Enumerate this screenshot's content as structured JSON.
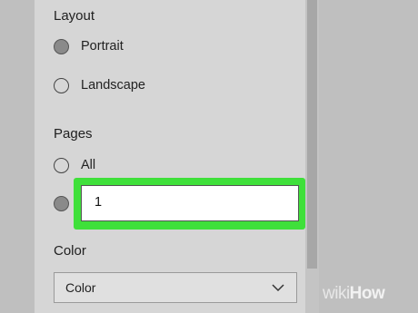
{
  "layout": {
    "title": "Layout",
    "options": [
      {
        "label": "Portrait",
        "selected": true
      },
      {
        "label": "Landscape",
        "selected": false
      }
    ]
  },
  "pages": {
    "title": "Pages",
    "options": [
      {
        "label": "All",
        "selected": false
      }
    ],
    "custom_selected": true,
    "custom_value": "1"
  },
  "color": {
    "title": "Color",
    "selected_value": "Color"
  },
  "watermark": {
    "part1": "wiki",
    "part2": "How"
  },
  "colors": {
    "panel": "#d6d6d6",
    "highlight": "#3fe03a"
  }
}
